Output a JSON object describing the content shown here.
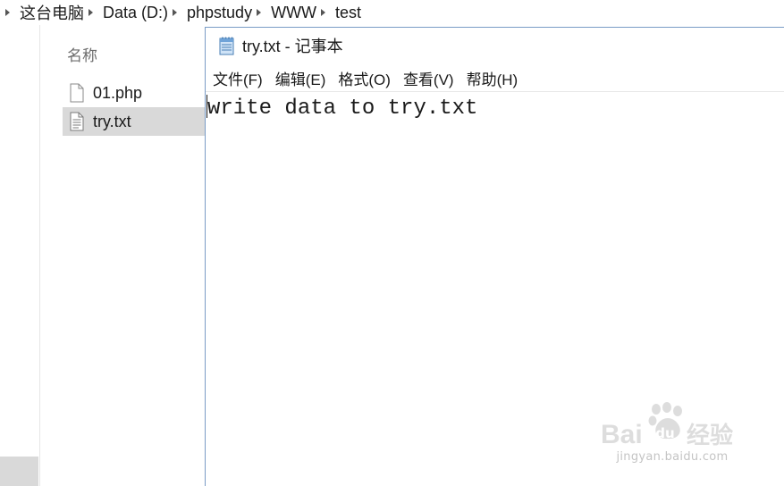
{
  "explorer": {
    "breadcrumb": [
      "这台电脑",
      "Data (D:)",
      "phpstudy",
      "WWW",
      "test"
    ],
    "column_header": "名称",
    "files": [
      {
        "name": "01.php",
        "icon": "blank-file-icon",
        "selected": false
      },
      {
        "name": "try.txt",
        "icon": "text-file-icon",
        "selected": true
      }
    ]
  },
  "notepad": {
    "title": "try.txt - 记事本",
    "menu": [
      "文件(F)",
      "编辑(E)",
      "格式(O)",
      "查看(V)",
      "帮助(H)"
    ],
    "content": "write data to try.txt"
  },
  "watermark": {
    "logo": "Bai du 经验",
    "url": "jingyan.baidu.com"
  }
}
